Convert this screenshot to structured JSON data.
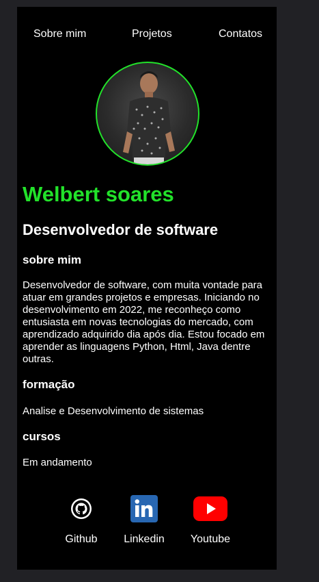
{
  "nav": {
    "items": [
      "Sobre mim",
      "Projetos",
      "Contatos"
    ]
  },
  "profile": {
    "name": "Welbert soares",
    "role": "Desenvolvedor de software"
  },
  "about": {
    "heading": "sobre mim",
    "text": "Desenvolvedor de software, com muita vontade para atuar em grandes projetos e empresas. Iniciando no desenvolvimento em 2022, me reconheço como entusiasta em novas tecnologias do mercado, com aprendizado adquirido dia após dia. Estou focado em aprender as linguagens Python, Html, Java dentre outras."
  },
  "education": {
    "heading": "formação",
    "text": "Analise e Desenvolvimento de sistemas"
  },
  "courses": {
    "heading": "cursos",
    "text": "Em andamento"
  },
  "social": {
    "github": {
      "label": "Github",
      "icon": "github-icon"
    },
    "linkedin": {
      "label": "Linkedin",
      "icon": "linkedin-icon"
    },
    "youtube": {
      "label": "Youtube",
      "icon": "youtube-icon"
    }
  },
  "colors": {
    "accent": "#22e22a",
    "background": "#000000",
    "outer_background": "#212125",
    "linkedin": "#2867b2",
    "youtube": "#ff0000"
  }
}
